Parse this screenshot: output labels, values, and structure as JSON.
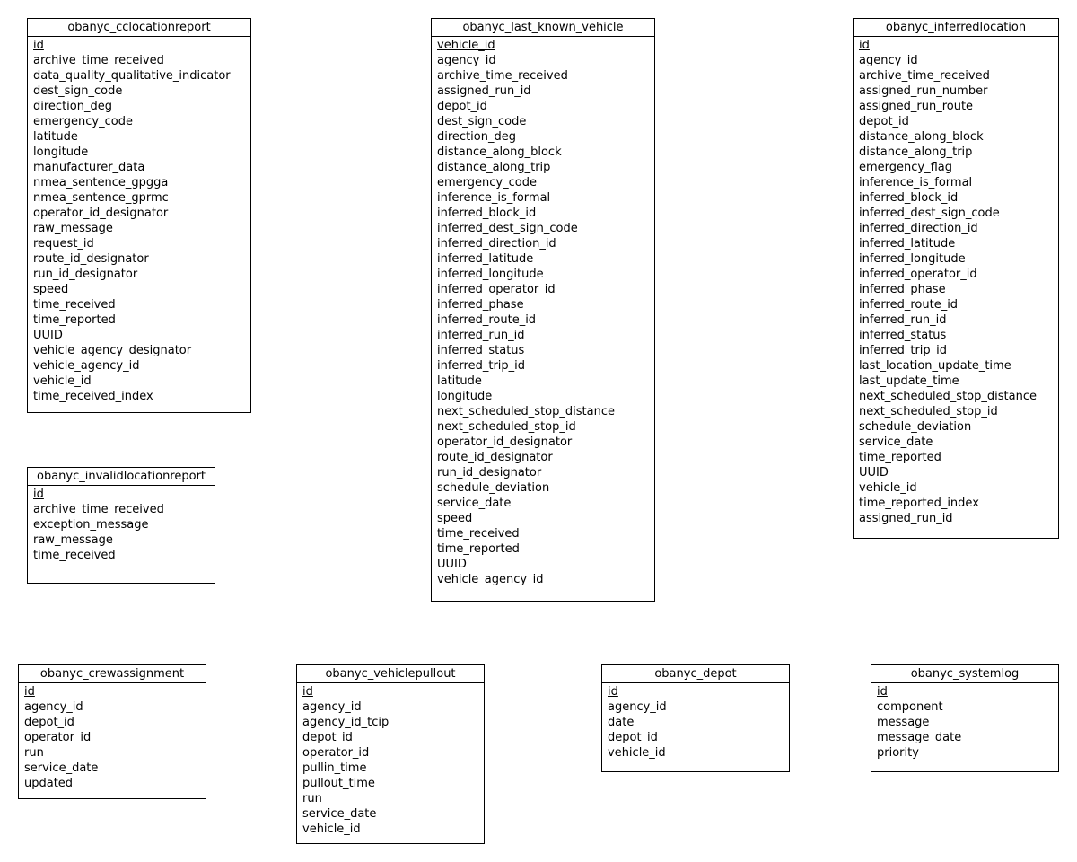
{
  "diagram": {
    "entities": [
      {
        "name": "obanyc_cclocationreport",
        "primary_key": "id",
        "attributes": [
          "id",
          "archive_time_received",
          "data_quality_qualitative_indicator",
          "dest_sign_code",
          "direction_deg",
          "emergency_code",
          "latitude",
          "longitude",
          "manufacturer_data",
          "nmea_sentence_gpgga",
          "nmea_sentence_gprmc",
          "operator_id_designator",
          "raw_message",
          "request_id",
          "route_id_designator",
          "run_id_designator",
          "speed",
          "time_received",
          "time_reported",
          "UUID",
          "vehicle_agency_designator",
          "vehicle_agency_id",
          "vehicle_id",
          "time_received_index"
        ]
      },
      {
        "name": "obanyc_last_known_vehicle",
        "primary_key": "vehicle_id",
        "attributes": [
          "vehicle_id",
          "agency_id",
          "archive_time_received",
          "assigned_run_id",
          "depot_id",
          "dest_sign_code",
          "direction_deg",
          "distance_along_block",
          "distance_along_trip",
          "emergency_code",
          "inference_is_formal",
          "inferred_block_id",
          "inferred_dest_sign_code",
          "inferred_direction_id",
          "inferred_latitude",
          "inferred_longitude",
          "inferred_operator_id",
          "inferred_phase",
          "inferred_route_id",
          "inferred_run_id",
          "inferred_status",
          "inferred_trip_id",
          "latitude",
          "longitude",
          "next_scheduled_stop_distance",
          "next_scheduled_stop_id",
          "operator_id_designator",
          "route_id_designator",
          "run_id_designator",
          "schedule_deviation",
          "service_date",
          "speed",
          "time_received",
          "time_reported",
          "UUID",
          "vehicle_agency_id"
        ]
      },
      {
        "name": "obanyc_inferredlocation",
        "primary_key": "id",
        "attributes": [
          "id",
          "agency_id",
          "archive_time_received",
          "assigned_run_number",
          "assigned_run_route",
          "depot_id",
          "distance_along_block",
          "distance_along_trip",
          "emergency_flag",
          "inference_is_formal",
          "inferred_block_id",
          "inferred_dest_sign_code",
          "inferred_direction_id",
          "inferred_latitude",
          "inferred_longitude",
          "inferred_operator_id",
          "inferred_phase",
          "inferred_route_id",
          "inferred_run_id",
          "inferred_status",
          "inferred_trip_id",
          "last_location_update_time",
          "last_update_time",
          "next_scheduled_stop_distance",
          "next_scheduled_stop_id",
          "schedule_deviation",
          "service_date",
          "time_reported",
          "UUID",
          "vehicle_id",
          "time_reported_index",
          "assigned_run_id"
        ]
      },
      {
        "name": "obanyc_invalidlocationreport",
        "primary_key": "id",
        "attributes": [
          "id",
          "archive_time_received",
          "exception_message",
          "raw_message",
          "time_received"
        ]
      },
      {
        "name": "obanyc_crewassignment",
        "primary_key": "id",
        "attributes": [
          "id",
          "agency_id",
          "depot_id",
          "operator_id",
          "run",
          "service_date",
          "updated"
        ]
      },
      {
        "name": "obanyc_vehiclepullout",
        "primary_key": "id",
        "attributes": [
          "id",
          "agency_id",
          "agency_id_tcip",
          "depot_id",
          "operator_id",
          "pullin_time",
          "pullout_time",
          "run",
          "service_date",
          "vehicle_id"
        ]
      },
      {
        "name": "obanyc_depot",
        "primary_key": "id",
        "attributes": [
          "id",
          "agency_id",
          "date",
          "depot_id",
          "vehicle_id"
        ]
      },
      {
        "name": "obanyc_systemlog",
        "primary_key": "id",
        "attributes": [
          "id",
          "component",
          "message",
          "message_date",
          "priority"
        ]
      }
    ]
  }
}
